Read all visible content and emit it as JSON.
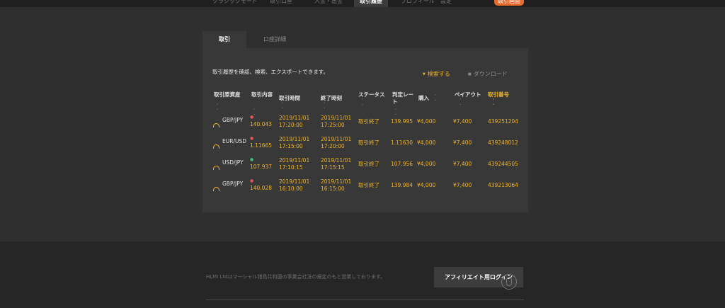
{
  "nav": {
    "items": [
      "クラシックモード",
      "取引口座",
      "入金・出金",
      "取引履歴",
      "プロフィール",
      "設定"
    ],
    "badge": "取引画面"
  },
  "tabs": {
    "trade": "取引",
    "account": "口座詳細"
  },
  "intro": "取引履歴を確認、検索、エクスポートできます。",
  "actions": {
    "search": "検索する",
    "download": "ダウンロード"
  },
  "columns": [
    "取引原資産",
    "取引内容",
    "取引時間",
    "終了時刻",
    "ステータス",
    "判定レート",
    "購入",
    "ペイアウト",
    "取引番号"
  ],
  "rows": [
    {
      "asset": "GBP/JPY",
      "direction": "down",
      "rate": "140.043",
      "start_date": "2019/11/01",
      "start_time": "17:20:00",
      "end_date": "2019/11/01",
      "end_time": "17:25:00",
      "status": "取引終了",
      "judge_rate": "139.995",
      "purchase": "¥4,000",
      "payout": "¥7,400",
      "trade_no": "439251204"
    },
    {
      "asset": "EUR/USD",
      "direction": "down",
      "rate": "1.11665",
      "start_date": "2019/11/01",
      "start_time": "17:15:00",
      "end_date": "2019/11/01",
      "end_time": "17:20:00",
      "status": "取引終了",
      "judge_rate": "1.11630",
      "purchase": "¥4,000",
      "payout": "¥7,400",
      "trade_no": "439248012"
    },
    {
      "asset": "USD/JPY",
      "direction": "up",
      "rate": "107.937",
      "start_date": "2019/11/01",
      "start_time": "17:10:15",
      "end_date": "2019/11/01",
      "end_time": "17:15:15",
      "status": "取引終了",
      "judge_rate": "107.956",
      "purchase": "¥4,000",
      "payout": "¥7,400",
      "trade_no": "439244505"
    },
    {
      "asset": "GBP/JPY",
      "direction": "down",
      "rate": "140.028",
      "start_date": "2019/11/01",
      "start_time": "16:10:00",
      "end_date": "2019/11/01",
      "end_time": "16:15:00",
      "status": "取引終了",
      "judge_rate": "139.984",
      "purchase": "¥4,000",
      "payout": "¥7,400",
      "trade_no": "439213064"
    }
  ],
  "footer": {
    "text": "HLMI Ltdはマーシャル諸島共和国の事業会社法の規定のもと営業しております。",
    "affiliate_login": "アフィリエイト用ログイン"
  },
  "colors": {
    "accent": "#f0b429",
    "down": "#e05656",
    "up": "#3bbd73",
    "badge": "#e56a2c"
  }
}
